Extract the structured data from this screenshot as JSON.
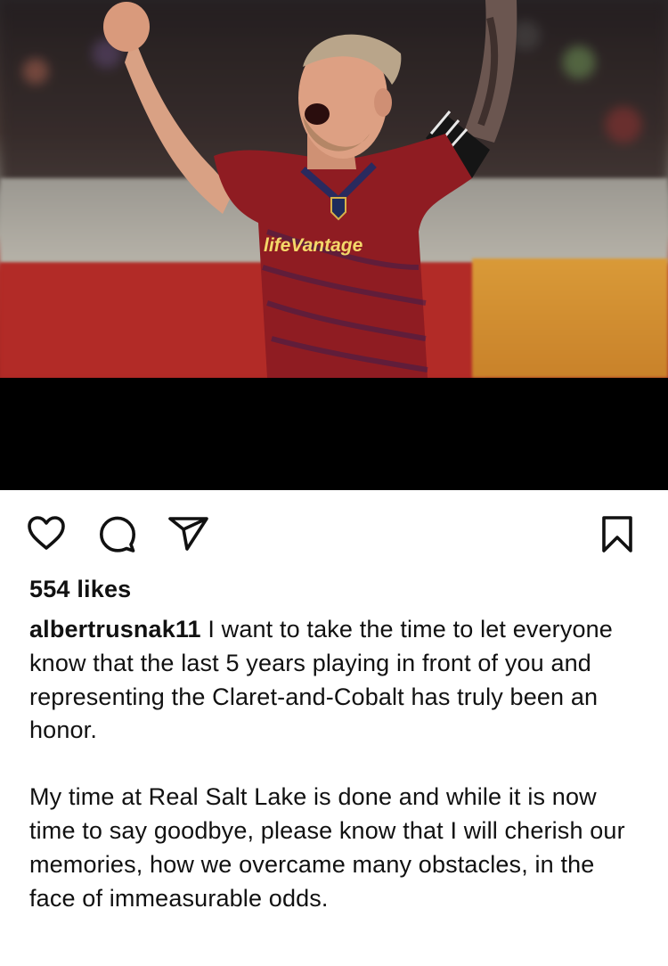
{
  "post": {
    "image": {
      "subject": "soccer-player-celebrating",
      "shirt_sponsor_text": "lifeVantage",
      "colors": {
        "jersey": "#8f1c22",
        "ad_board_red": "#b22b27",
        "ad_board_gold": "#d99a38"
      }
    },
    "actions": {
      "like_icon": "heart-icon",
      "comment_icon": "comment-icon",
      "share_icon": "send-icon",
      "save_icon": "bookmark-icon"
    },
    "likes_text": "554 likes",
    "caption": {
      "username": "albertrusnak11",
      "paragraph_1": "I want to take the time to let everyone know that the last 5 years playing in front of you and representing the Claret-and-Cobalt has truly been an honor.",
      "paragraph_2": "My time at Real Salt Lake is done and while it is now time to say goodbye, please know that I will cherish our memories, how we overcame many obstacles, in the face of immeasurable odds."
    }
  }
}
